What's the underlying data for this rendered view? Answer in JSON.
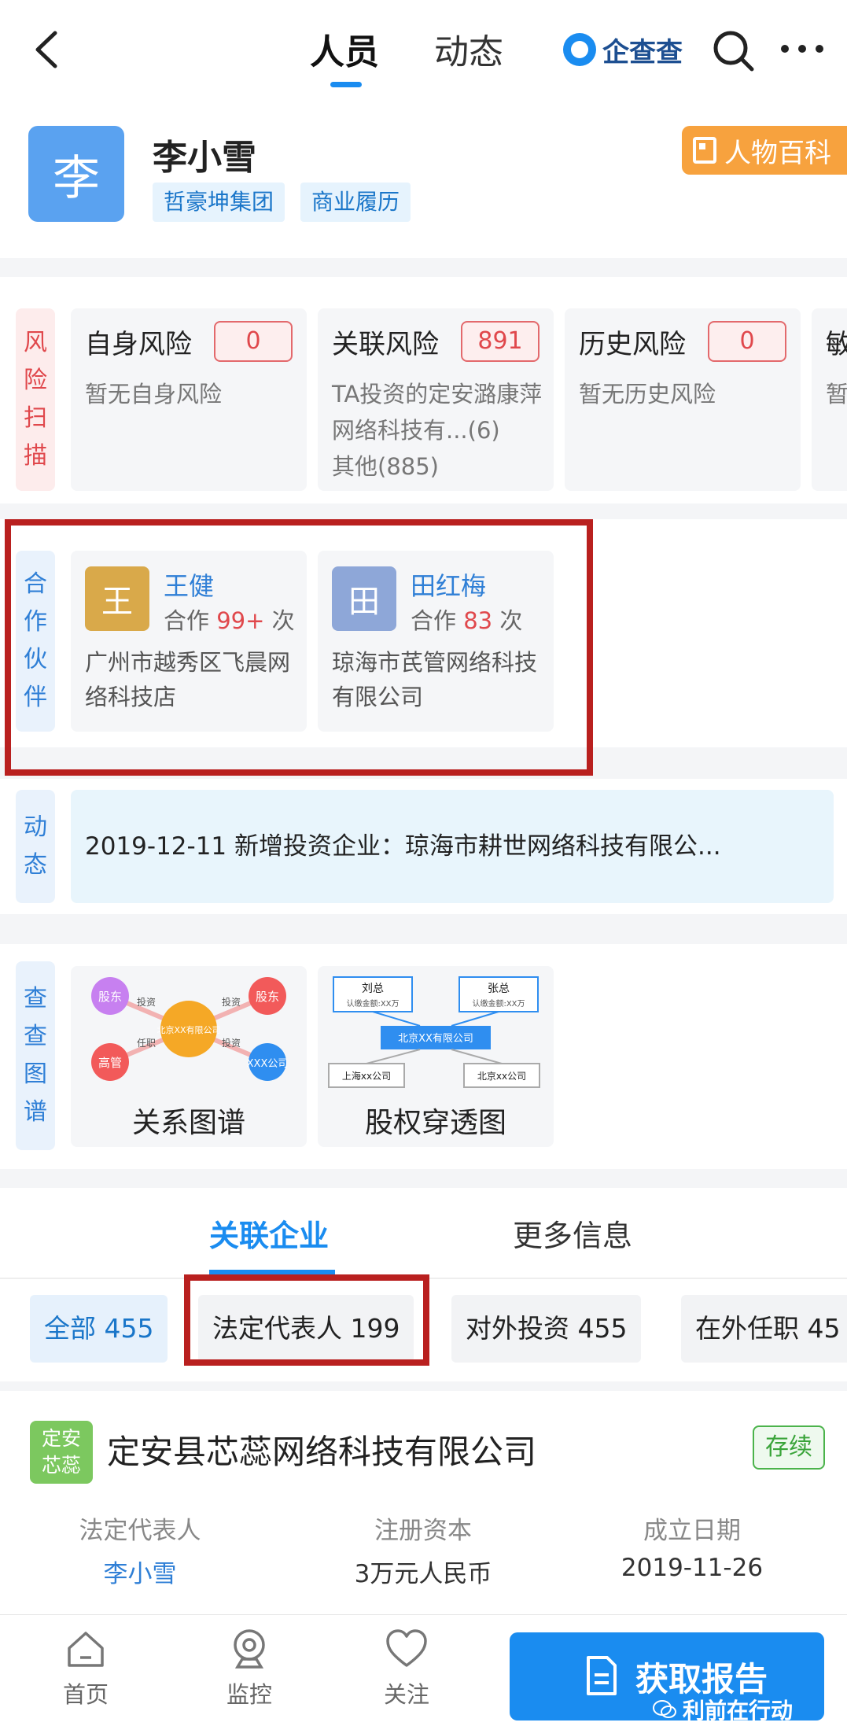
{
  "nav": {
    "tabs": [
      "人员",
      "动态"
    ],
    "brand": "企查查"
  },
  "profile": {
    "avatar_char": "李",
    "name": "李小雪",
    "tags": [
      "哲豪坤集团",
      "商业履历"
    ],
    "baike": "人物百科"
  },
  "risk": {
    "label_chars": [
      "风",
      "险",
      "扫",
      "描"
    ],
    "cards": [
      {
        "title": "自身风险",
        "count": "0",
        "desc": "暂无自身风险"
      },
      {
        "title": "关联风险",
        "count": "891",
        "desc": "TA投资的定安潞康萍网络科技有...(6)",
        "desc2": "其他(885)"
      },
      {
        "title": "历史风险",
        "count": "0",
        "desc": "暂无历史风险"
      },
      {
        "title": "敏",
        "desc": "暂"
      }
    ]
  },
  "partners": {
    "label_chars": [
      "合",
      "作",
      "伙",
      "伴"
    ],
    "items": [
      {
        "avatar": "王",
        "name": "王健",
        "coop_prefix": "合作 ",
        "coop_num": "99+",
        "coop_suffix": " 次",
        "company": "广州市越秀区飞晨网络科技店",
        "color": "#d9a94a"
      },
      {
        "avatar": "田",
        "name": "田红梅",
        "coop_prefix": "合作 ",
        "coop_num": "83",
        "coop_suffix": " 次",
        "company": "琼海市芪管网络科技有限公司",
        "color": "#8ea7d8"
      }
    ]
  },
  "dynamic": {
    "label_chars": [
      "动",
      "态"
    ],
    "text": "2019-12-11 新增投资企业：琼海市耕世网络科技有限公..."
  },
  "graph": {
    "label_chars": [
      "查",
      "查",
      "图",
      "谱"
    ],
    "cards": [
      {
        "label": "关系图谱",
        "nodes": {
          "shareholder_a": "股东",
          "center": "北京XX有限公司",
          "shareholder_b": "股东",
          "executive": "高管",
          "company": "XXX公司",
          "invest_a": "投资",
          "invest_b": "投资",
          "position": "任职",
          "invest_c": "投资"
        }
      },
      {
        "label": "股权穿透图",
        "nodes": {
          "liu_name": "刘总",
          "liu_sub": "认缴金额:XX万",
          "zhang_name": "张总",
          "zhang_sub": "认缴金额:XX万",
          "center": "北京XX有限公司",
          "sh": "上海xx公司",
          "bj": "北京xx公司"
        }
      }
    ]
  },
  "related": {
    "tabs": [
      "关联企业",
      "更多信息"
    ],
    "chips": [
      "全部 455",
      "法定代表人 199",
      "对外投资 455",
      "在外任职 45"
    ]
  },
  "company": {
    "logo": "定安芯蕊",
    "logo_line1": "定安",
    "logo_line2": "芯蕊",
    "name": "定安县芯蕊网络科技有限公司",
    "status": "存续",
    "legal_label": "法定代表人",
    "legal_value": "李小雪",
    "capital_label": "注册资本",
    "capital_value": "3万元人民币",
    "date_label": "成立日期",
    "date_value": "2019-11-26"
  },
  "bottom": {
    "items": [
      "首页",
      "监控",
      "关注"
    ],
    "report": "获取报告",
    "watermark": "利前在行动"
  },
  "colors": {
    "accent": "#1a8cf0",
    "risk_red": "#e0484c",
    "highlight": "#b9201f",
    "baike_orange": "#f7a23e"
  }
}
